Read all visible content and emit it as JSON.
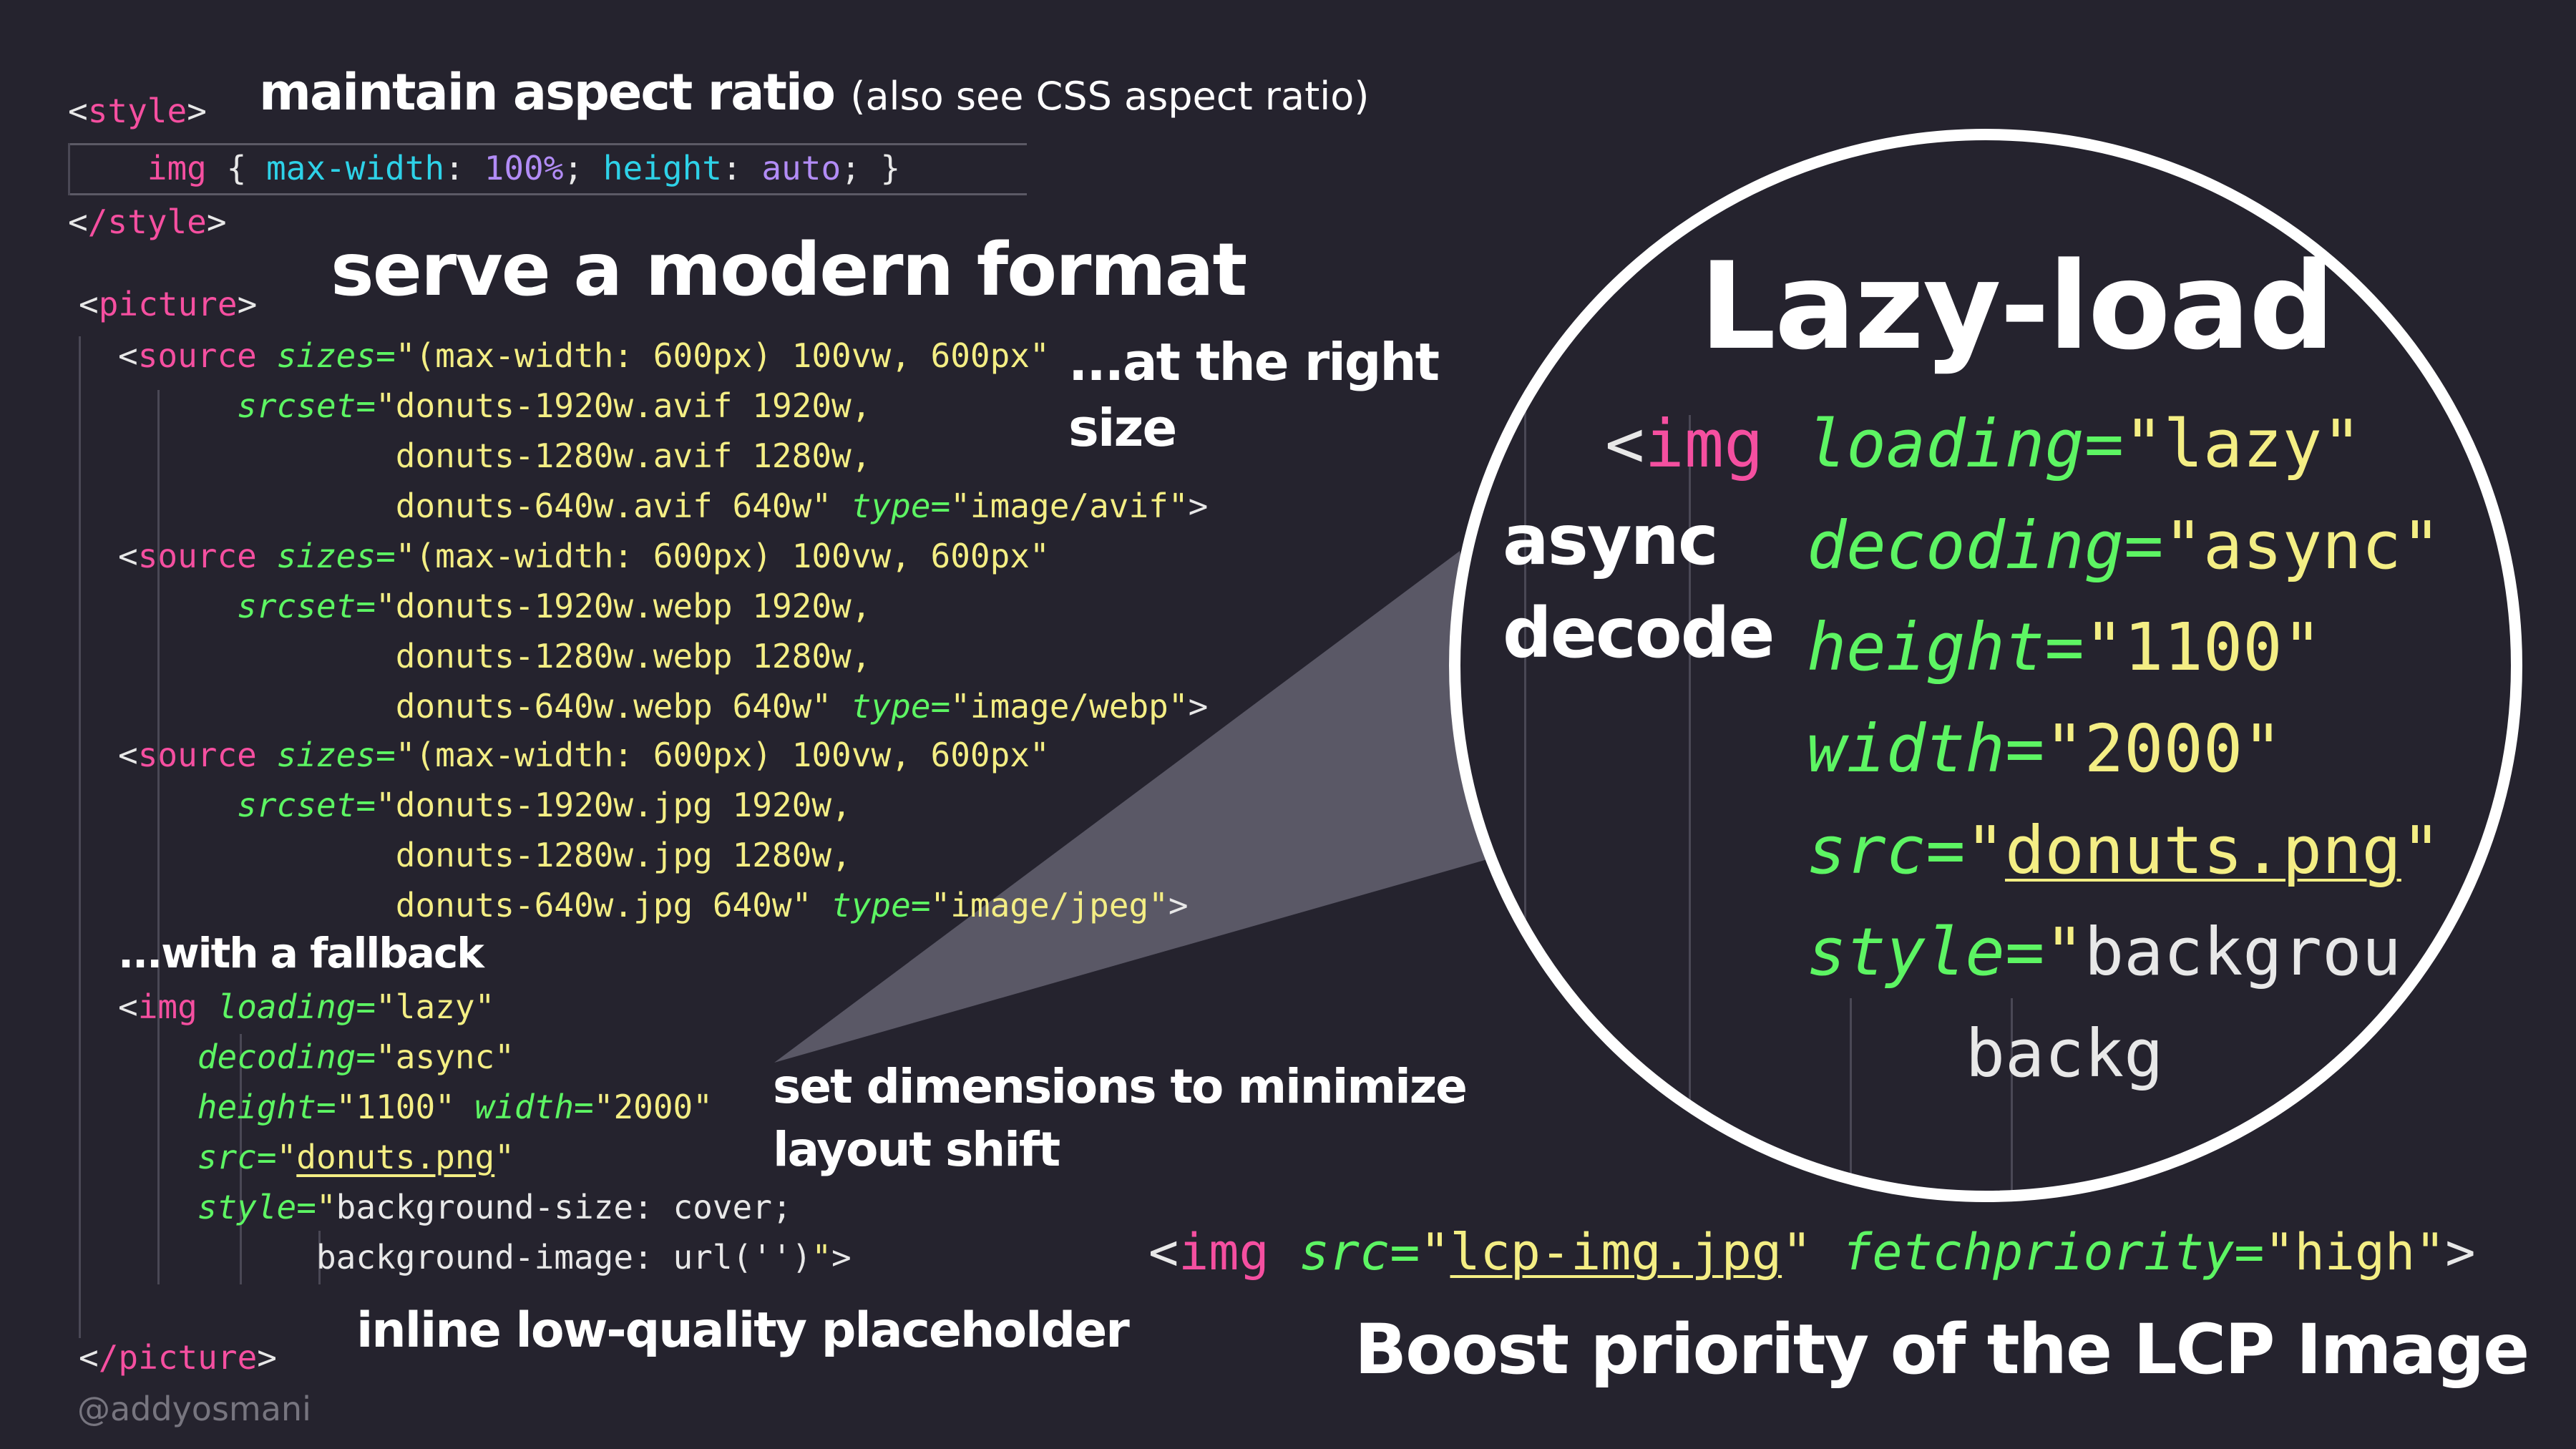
{
  "headings": {
    "aspect_main": "maintain aspect ratio",
    "aspect_note": "(also see CSS aspect ratio)",
    "modern_format": "serve a modern format",
    "right_size_line1": "...at the right",
    "right_size_line2": "size",
    "fallback": "...with a fallback",
    "dimensions_line1": "set dimensions to  minimize",
    "dimensions_line2": "layout shift",
    "placeholder": "inline low-quality placeholder",
    "lazy_load": "Lazy-load",
    "async_line1": "async",
    "async_line2": "decode",
    "boost": "Boost priority of the LCP Image",
    "author": "@addyosmani"
  },
  "style_block": {
    "open_tag": "style",
    "close_tag": "/style",
    "selector": "img",
    "prop1": "max-width",
    "val1": "100%",
    "prop2": "height",
    "val2": "auto"
  },
  "picture": {
    "open_tag": "picture",
    "close_tag": "/picture",
    "sources": [
      {
        "tag": "source",
        "sizes": "(max-width: 600px) 100vw, 600px",
        "srcset": [
          "donuts-1920w.avif 1920w,",
          "donuts-1280w.avif 1280w,",
          "donuts-640w.avif 640w"
        ],
        "type": "image/avif"
      },
      {
        "tag": "source",
        "sizes": "(max-width: 600px) 100vw, 600px",
        "srcset": [
          "donuts-1920w.webp 1920w,",
          "donuts-1280w.webp 1280w,",
          "donuts-640w.webp 640w"
        ],
        "type": "image/webp"
      },
      {
        "tag": "source",
        "sizes": "(max-width: 600px) 100vw, 600px",
        "srcset": [
          "donuts-1920w.jpg 1920w,",
          "donuts-1280w.jpg 1280w,",
          "donuts-640w.jpg 640w"
        ],
        "type": "image/jpeg"
      }
    ],
    "img": {
      "tag": "img",
      "loading": "lazy",
      "decoding": "async",
      "height": "1100",
      "width": "2000",
      "src": "donuts.png",
      "style_line1": "background-size: cover;",
      "style_line2": "background-image: url('')"
    }
  },
  "zoom": {
    "tag": "img",
    "loading": "lazy",
    "decoding": "async",
    "height": "1100",
    "width": "2000",
    "src": "donuts.png",
    "style_partial": "backgrou",
    "style_line2_partial": "backg"
  },
  "lcp": {
    "tag": "img",
    "src": "lcp-img.jpg",
    "fetchpriority": "high"
  },
  "attr_names": {
    "sizes": "sizes",
    "srcset": "srcset",
    "type": "type",
    "loading": "loading",
    "decoding": "decoding",
    "height": "height",
    "width": "width",
    "src": "src",
    "style": "style",
    "fetchpriority": "fetchpriority"
  },
  "colors": {
    "background": "#25232e",
    "tag": "#f54fa0",
    "attribute": "#5df563",
    "string": "#f4ee84",
    "css_property": "#2ed2e8",
    "css_value": "#b28cf6",
    "callout": "#5a5866"
  }
}
